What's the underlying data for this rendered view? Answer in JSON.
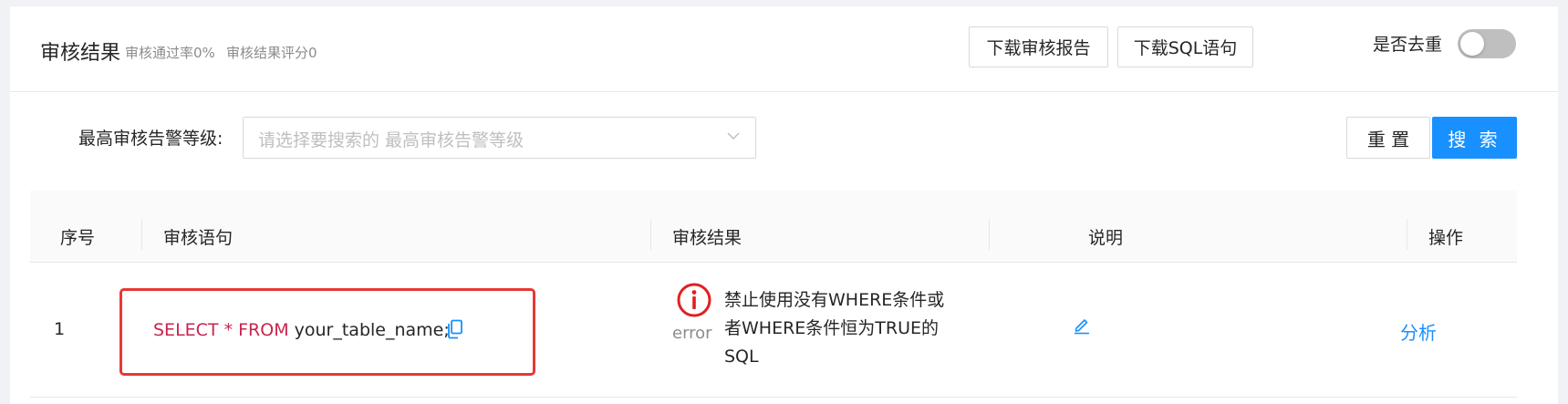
{
  "header": {
    "title": "审核结果",
    "pass_rate": "审核通过率0%",
    "score": "审核结果评分0",
    "download_report_label": "下载审核报告",
    "download_sql_label": "下载SQL语句",
    "dedup_label": "是否去重",
    "dedup_enabled": false
  },
  "filter": {
    "label": "最高审核告警等级:",
    "placeholder": "请选择要搜索的 最高审核告警等级",
    "reset_label": "重 置",
    "search_label": "搜 索"
  },
  "table": {
    "columns": [
      "序号",
      "审核语句",
      "审核结果",
      "说明",
      "操作"
    ],
    "rows": [
      {
        "index": "1",
        "sql_keyword1": "SELECT * FROM",
        "sql_rest": " your_table_name;",
        "result_level": "error",
        "result_message": "禁止使用没有WHERE条件或者WHERE条件恒为TRUE的SQL",
        "action": "分析"
      }
    ]
  },
  "colors": {
    "primary": "#1890ff",
    "error": "#e53935",
    "sql_keyword": "#c7254e"
  },
  "icons": [
    "copy-icon",
    "error-info-icon",
    "edit-icon",
    "chevron-down-icon"
  ]
}
